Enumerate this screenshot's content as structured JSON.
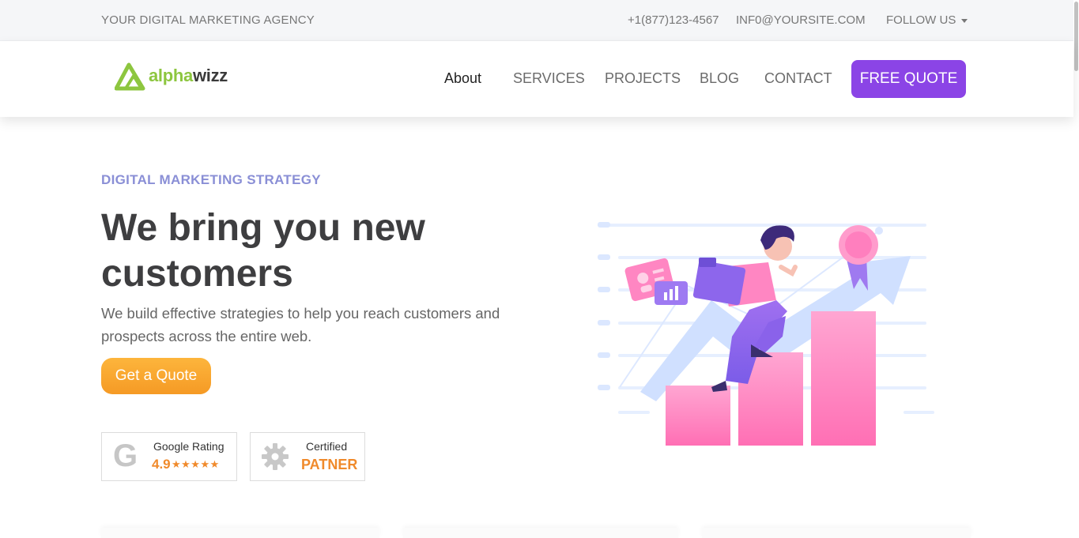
{
  "topbar": {
    "tagline": "YOUR DIGITAL MARKETING AGENCY",
    "phone": "+1(877)123-4567",
    "email": "INF0@YOURSITE.COM",
    "follow": "FOLLOW US"
  },
  "brand": {
    "part1": "alpha",
    "part2": "wizz",
    "color1": "#8dc63f",
    "color2": "#3a3a3a"
  },
  "nav": {
    "items": [
      "About",
      "SERVICES",
      "PROJECTS",
      "BLOG",
      "CONTACT"
    ],
    "active": "About",
    "quote_button": "FREE QUOTE"
  },
  "hero": {
    "eyebrow": "DIGITAL MARKETING STRATEGY",
    "headline": "We bring you new customers",
    "subtext": "We build effective strategies to help you reach customers and prospects across the entire web.",
    "cta": "Get a Quote"
  },
  "badges": {
    "google": {
      "letter": "G",
      "label": "Google Rating",
      "rating": "4.9",
      "stars": "★★★★★"
    },
    "certified": {
      "label": "Certified",
      "value": "PATNER"
    }
  },
  "colors": {
    "accent_purple": "#8b44e6",
    "accent_orange": "#f59a25",
    "eyebrow_blue": "#8a8fd6",
    "bars_pink": "#ff7fbf"
  },
  "icons": [
    "chevron-down-icon",
    "alphawizz-logo-icon",
    "google-g-icon",
    "gear-icon",
    "growth-illustration"
  ]
}
